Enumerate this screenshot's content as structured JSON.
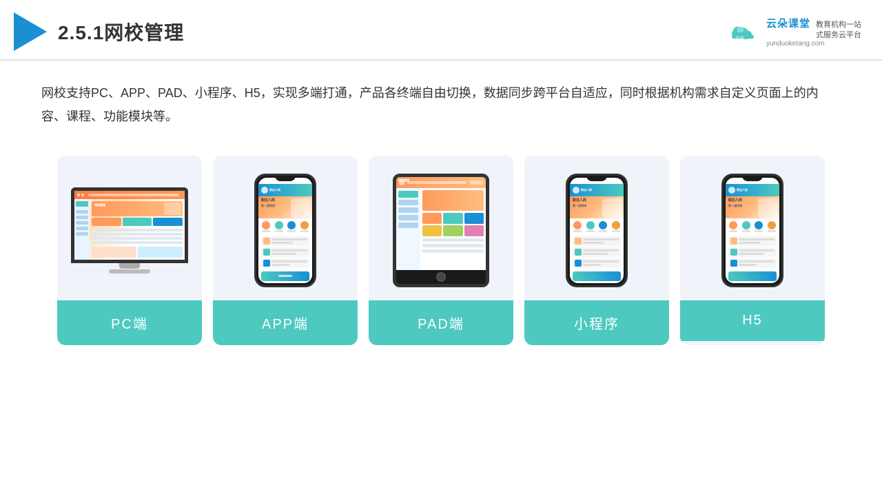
{
  "header": {
    "title": "2.5.1网校管理",
    "brand": {
      "name": "云朵课堂",
      "url": "yunduoketang.com",
      "slogan": "教育机构一站\n式服务云平台"
    }
  },
  "description": "网校支持PC、APP、PAD、小程序、H5，实现多端打通，产品各终端自由切换，数据同步跨平台自适应，同时根据机构需求自定义页面上的内容、课程、功能模块等。",
  "cards": [
    {
      "id": "pc",
      "label": "PC端",
      "type": "pc"
    },
    {
      "id": "app",
      "label": "APP端",
      "type": "phone"
    },
    {
      "id": "pad",
      "label": "PAD端",
      "type": "tablet"
    },
    {
      "id": "miniprogram",
      "label": "小程序",
      "type": "phone"
    },
    {
      "id": "h5",
      "label": "H5",
      "type": "phone"
    }
  ]
}
